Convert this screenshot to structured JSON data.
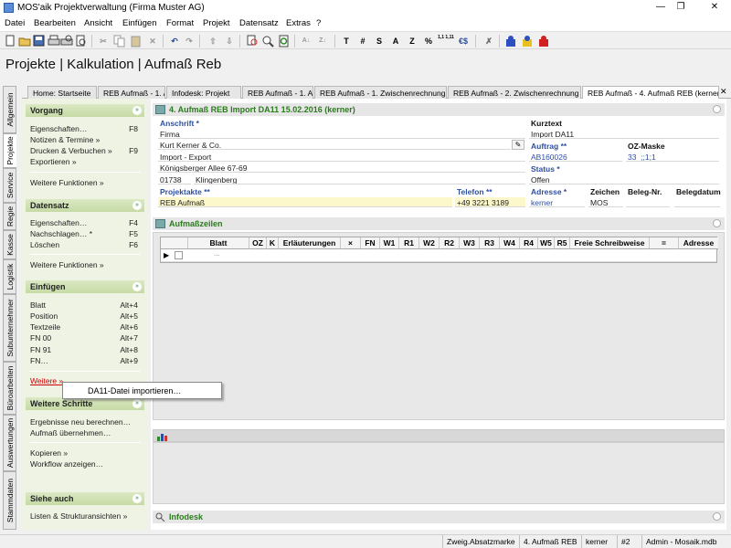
{
  "window": {
    "title": "MOS'aik Projektverwaltung (Firma Muster AG)",
    "minimize": "—",
    "maximize": "❐",
    "close": "✕"
  },
  "menu": [
    "Datei",
    "Bearbeiten",
    "Ansicht",
    "Einfügen",
    "Format",
    "Projekt",
    "Datensatz",
    "Extras",
    "?"
  ],
  "toolbar": {
    "icons": [
      "new-icon",
      "open-icon",
      "save-icon",
      "print-icon",
      "print-preview-icon",
      "preview-icon",
      "cut-icon",
      "copy-icon",
      "paste-icon",
      "delete-icon",
      "undo-icon",
      "redo-icon",
      "move-up-icon",
      "move-down-icon",
      "search-icon",
      "zoom-icon",
      "refresh-icon",
      "sort-icon",
      "sort-desc-icon"
    ],
    "text_buttons": [
      "T",
      "#",
      "S",
      "A",
      "Z",
      "%",
      "1,1 1,11",
      "€$"
    ],
    "extra_icons": [
      "tools-icon",
      "user-blue-icon",
      "user-lock-icon",
      "user-red-icon"
    ]
  },
  "page_title": "Projekte | Kalkulation | Aufmaß Reb",
  "doc_tabs": [
    {
      "label": "Home: Startseite",
      "active": false
    },
    {
      "label": "REB Aufmaß - 1. A",
      "active": false
    },
    {
      "label": "Infodesk: Projekt",
      "active": false
    },
    {
      "label": "REB Aufmaß - 1. A",
      "active": false
    },
    {
      "label": "REB Aufmaß - 1. Zwischenrechnung (",
      "active": false
    },
    {
      "label": "REB Aufmaß - 2. Zwischenrechnung (",
      "active": false
    },
    {
      "label": "REB Aufmaß - 4. Aufmaß REB (kerner)",
      "active": true
    }
  ],
  "tab_close": "✕",
  "side_tabs": [
    "Allgemein",
    "Projekte",
    "Service",
    "Regie",
    "Kasse",
    "Logistik",
    "Subunternehmer",
    "Büroarbeiten",
    "Auswertungen",
    "Stammdaten"
  ],
  "taskpane": {
    "vorgang": {
      "title": "Vorgang",
      "items": [
        {
          "label": "Eigenschaften…",
          "key": "F8"
        },
        {
          "label": "Notizen & Termine »",
          "key": ""
        },
        {
          "label": "Drucken & Verbuchen »",
          "key": "F9"
        },
        {
          "label": "Exportieren »",
          "key": ""
        }
      ],
      "more": "Weitere Funktionen »"
    },
    "datensatz": {
      "title": "Datensatz",
      "items": [
        {
          "label": "Eigenschaften…",
          "key": "F4"
        },
        {
          "label": "Nachschlagen… *",
          "key": "F5"
        },
        {
          "label": "Löschen",
          "key": "F6"
        }
      ],
      "more": "Weitere Funktionen »"
    },
    "einfuegen": {
      "title": "Einfügen",
      "items": [
        {
          "label": "Blatt",
          "key": "Alt+4"
        },
        {
          "label": "Position",
          "key": "Alt+5"
        },
        {
          "label": "Textzeile",
          "key": "Alt+6"
        },
        {
          "label": "FN 00",
          "key": "Alt+7"
        },
        {
          "label": "FN 91",
          "key": "Alt+8"
        },
        {
          "label": "FN…",
          "key": "Alt+9"
        }
      ],
      "more": "Weitere »"
    },
    "weitere_schritte": {
      "title": "Weitere Schritte",
      "items": [
        {
          "label": "Ergebnisse neu berechnen…"
        },
        {
          "label": "Aufmaß übernehmen…"
        },
        {
          "label": "Kopieren »"
        },
        {
          "label": "Workflow anzeigen…"
        }
      ]
    },
    "siehe_auch": {
      "title": "Siehe auch",
      "items": [
        {
          "label": "Listen & Strukturansichten »"
        }
      ]
    },
    "chevron": "»"
  },
  "popup": {
    "item": "DA11-Datei importieren…"
  },
  "header_panel": {
    "title": "4. Aufmaß REB Import DA11 15.02.2016 (kerner)",
    "anschrift_label": "Anschrift *",
    "anschrift": [
      "Firma",
      "Kurt Kerner & Co.",
      "Import - Export",
      "Königsberger Allee 67-69"
    ],
    "plz": "01738",
    "ort": "Klingenberg",
    "kurztext_label": "Kurztext",
    "kurztext": "Import DA11",
    "auftrag_label": "Auftrag **",
    "auftrag": "AB160026",
    "ozmaske_label": "OZ-Maske",
    "ozmaske": "33_;;1;1_",
    "status_label": "Status *",
    "status": "Offen",
    "projektakte_label": "Projektakte **",
    "projektakte": "REB Aufmaß",
    "telefon_label": "Telefon **",
    "telefon": "+49 3221 3189",
    "adresse_label": "Adresse *",
    "adresse": "kerner",
    "zeichen_label": "Zeichen",
    "zeichen": "MOS",
    "belegnr_label": "Beleg-Nr.",
    "belegnr": "",
    "belegdatum_label": "Belegdatum",
    "belegdatum": ""
  },
  "grid_panel": {
    "title": "Aufmaßzeilen",
    "columns": [
      "Blatt",
      "OZ",
      "K",
      "Erläuterungen",
      "×",
      "FN",
      "W1",
      "R1",
      "W2",
      "R2",
      "W3",
      "R3",
      "W4",
      "R4",
      "W5",
      "R5",
      "Freie Schreibweise",
      "=",
      "Adresse"
    ],
    "new_row_marker": "..."
  },
  "infodesk": {
    "title": "Infodesk"
  },
  "statusbar": [
    "Zweig.Absatzmarke",
    "4. Aufmaß REB",
    "kerner",
    "#2",
    "Admin - Mosaik.mdb"
  ],
  "colors": {
    "accent_green": "#2b7a1d",
    "label_blue": "#2d4fa0",
    "taskpane_bg": "#eef3e3"
  }
}
